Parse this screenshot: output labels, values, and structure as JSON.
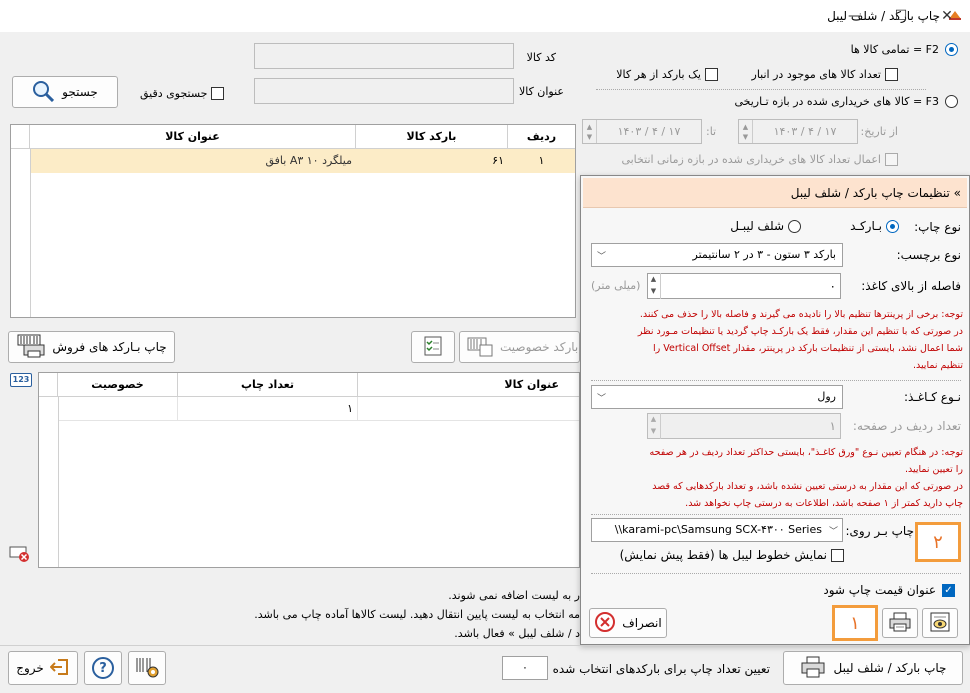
{
  "window": {
    "title": "چاپ بارکد / شلف لیبل",
    "minimize": "—",
    "maximize": "☐",
    "close": "✕"
  },
  "search": {
    "code_label": "کد کالا",
    "name_label": "عنوان کالا",
    "exact_label": "جستجوی دقیق",
    "button_label": "جستجو"
  },
  "options": {
    "all_goods": "F2 = تمامی کالا ها",
    "qty_in_stock": "تعداد کالا های موجود در انبار",
    "one_per_item": "یک بارکد از هر کالا",
    "purchased_range": "F3 = کالا های خریداری شده در بازه تـاریخی",
    "from_label": "از تاریخ:",
    "from_date": "۱۴۰۳ / ۴ / ۱۷",
    "to_label": "تا:",
    "to_date": "۱۴۰۳ / ۴ / ۱۷",
    "apply_qty": "اعمال تعداد کالا های خریداری شده در بازه زمانی انتخابی"
  },
  "top_grid": {
    "headers": [
      "ردیف",
      "بارکد کالا",
      "عنوان کالا"
    ],
    "rows": [
      {
        "row": "۱",
        "barcode": "۶۱",
        "name": "میلگرد ۱۰ A۳ بافق"
      }
    ]
  },
  "toolbar": {
    "print_sales": "چاپ بـارکد های فروش",
    "print_attr": "بارکد خصوصیت"
  },
  "bottom_grid": {
    "headers": [
      "عنوان کالا",
      "تعداد چاپ",
      "خصوصیت"
    ],
    "rows": [
      {
        "name": "",
        "count": "۱",
        "attr": ""
      }
    ],
    "badge": "123"
  },
  "notes": {
    "l1": "ر به لیست اضافه نمی شوند.",
    "l2": "مه انتخاب به لیست پایین انتقال دهید. لیست کالاها آماده چاپ می باشد.",
    "l3": "د / شلف لیبل » فعال باشد."
  },
  "settings": {
    "header": "» تنظیمات چاپ بارکد / شلف لیبل",
    "print_type_label": "نوع چاپ:",
    "barcode_opt": "بـارکـد",
    "shelf_opt": "شلف لیبـل",
    "label_type_label": "نوع برچسب:",
    "label_type_value": "بارکد ۳ ستون - ۳ در ۲ سانتیمتر",
    "top_margin_label": "فاصله از بالای کاغذ:",
    "top_margin_value": "۰",
    "top_margin_unit": "(میلی متر)",
    "note1": [
      "توجه: برخی از پرینترها تنظیم بالا را نادیده می گیرند و فاصله بالا را حذف می کنند.",
      "در صورتی که با تنظیم این مقدار، فقط یک بارکـد چاپ گردید یا تنظیمات مـورد نظر",
      "شما اعمال نشد، بایستی از تنظیمات بارکد در پرینتر، مقدار Vertical Offset را",
      "تنظیم نمایید."
    ],
    "paper_type_label": "نـوع کـاغـذ:",
    "paper_type_value": "رول",
    "rows_per_page_label": "تعداد ردیف در صفحه:",
    "rows_per_page_value": "۱",
    "note2": [
      "توجه: در هنگام تعیین نـوع \"ورق کاغـذ\"، بایستی حداکثر تعداد ردیف در هر صفحه",
      "را تعیین نمایید.",
      "در صورتی که این مقدار به درستی تعیین نشده باشد، و تعداد بارکدهایی که قصد",
      "چاپ دارید کمتر از ۱ صفحه باشد، اطلاعات به درستی چاپ نخواهد شد."
    ],
    "print_on_label": "چاپ بـر روی:",
    "printer_value": "\\\\karami-pc\\Samsung SCX-۴۳۰۰ Series",
    "show_lines": "نمایش خطوط لیبل ها (فقط پیش نمایش)",
    "price_title": "عنوان قیمت چاپ شود",
    "cancel_label": "انصراف"
  },
  "markers": {
    "m1": "۱",
    "m2": "۲"
  },
  "footer": {
    "print_button": "چاپ بارکد / شلف لیبل",
    "set_count_label": "تعیین تعداد چاپ برای بارکدهای انتخاب شده",
    "count_value": "۰",
    "exit_label": "خروج",
    "help_label": "?"
  }
}
